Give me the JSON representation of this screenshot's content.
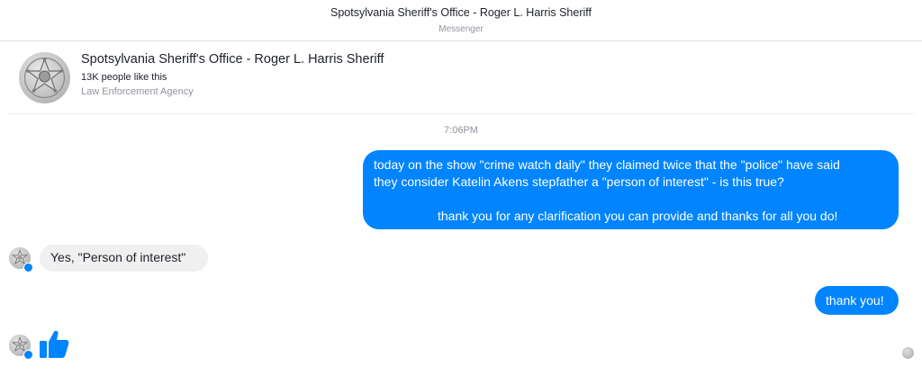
{
  "window": {
    "title": "Spotsylvania Sheriff's Office - Roger L. Harris Sheriff",
    "subtitle": "Messenger"
  },
  "page": {
    "name": "Spotsylvania Sheriff's Office - Roger L. Harris Sheriff",
    "likes": "13K people like this",
    "category": "Law Enforcement Agency",
    "avatar_icon": "sheriff-star-badge-icon"
  },
  "conversation": {
    "timestamp": "7:06PM",
    "messages": [
      {
        "direction": "outgoing",
        "lines": [
          "today on the show \"crime watch daily\" they claimed twice that the \"police\" have said",
          "they consider Katelin Akens stepfather a \"person of interest\" - is this true?",
          "thank you for any clarification you can provide and thanks for all you do!"
        ]
      },
      {
        "direction": "incoming",
        "text": "Yes, \"Person of interest\""
      },
      {
        "direction": "outgoing",
        "text": "thank you!"
      },
      {
        "direction": "incoming",
        "sticker": "thumbs-up-icon"
      }
    ]
  },
  "colors": {
    "outgoing_bubble": "#0084ff",
    "incoming_bubble": "#f1f0f0",
    "like_icon": "#0084ff"
  }
}
